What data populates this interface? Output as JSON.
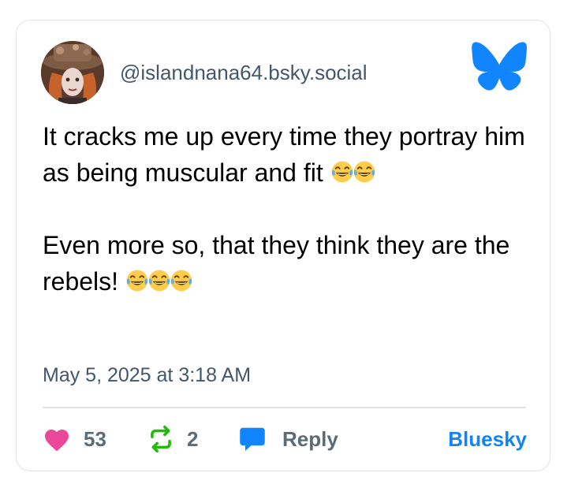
{
  "post": {
    "handle": "@islandnana64.bsky.social",
    "paragraphs": [
      {
        "text": "It cracks me up every time they portray him as being muscular and fit ",
        "emoji_count": 2
      },
      {
        "text": "Even more so, that they think they are the rebels! ",
        "emoji_count": 3
      }
    ],
    "emoji_name": "face-with-tears-of-joy",
    "timestamp": "May 5, 2025 at 3:18 AM"
  },
  "actions": {
    "like_count": "53",
    "repost_count": "2",
    "reply_label": "Reply",
    "platform_label": "Bluesky"
  },
  "icons": {
    "logo": "bluesky-butterfly-icon",
    "like": "heart-icon",
    "repost": "repost-icon",
    "reply": "reply-bubble-icon"
  },
  "colors": {
    "brand_blue": "#1185fe",
    "link_blue": "#1284f5",
    "like_pink": "#ec4899",
    "repost_green": "#20bc07",
    "secondary_text": "#42576c",
    "count_text": "#5d6a78"
  }
}
